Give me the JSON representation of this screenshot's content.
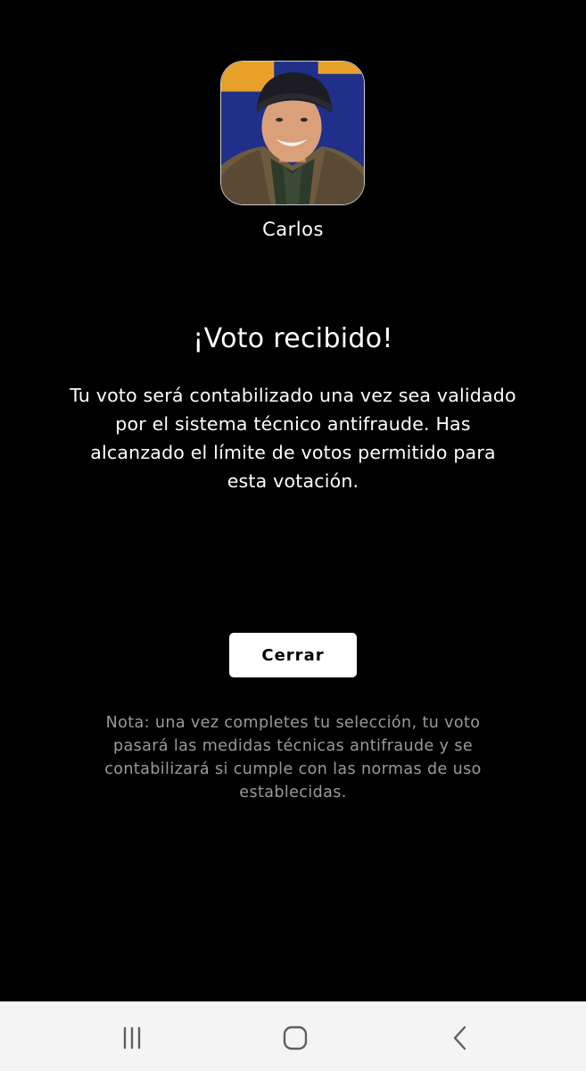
{
  "candidate": {
    "name": "Carlos",
    "photo": "portrait-photo"
  },
  "vote": {
    "title": "¡Voto recibido!",
    "message": "Tu voto será contabilizado una vez sea validado por el sistema técnico antifraude. Has alcanzado el límite de votos permitido para esta votación."
  },
  "actions": {
    "close_label": "Cerrar"
  },
  "note": "Nota: una vez completes tu selección, tu voto pasará las medidas técnicas antifraude y se contabilizará si cumple con las normas de uso establecidas.",
  "navigation": {
    "recents_icon": "recent-apps-icon",
    "home_icon": "home-icon",
    "back_icon": "back-icon"
  },
  "colors": {
    "background": "#000000",
    "primary_text": "#ffffff",
    "note_text": "#9a9a9a",
    "button_bg": "#ffffff",
    "nav_bar_bg": "#f4f4f4"
  }
}
